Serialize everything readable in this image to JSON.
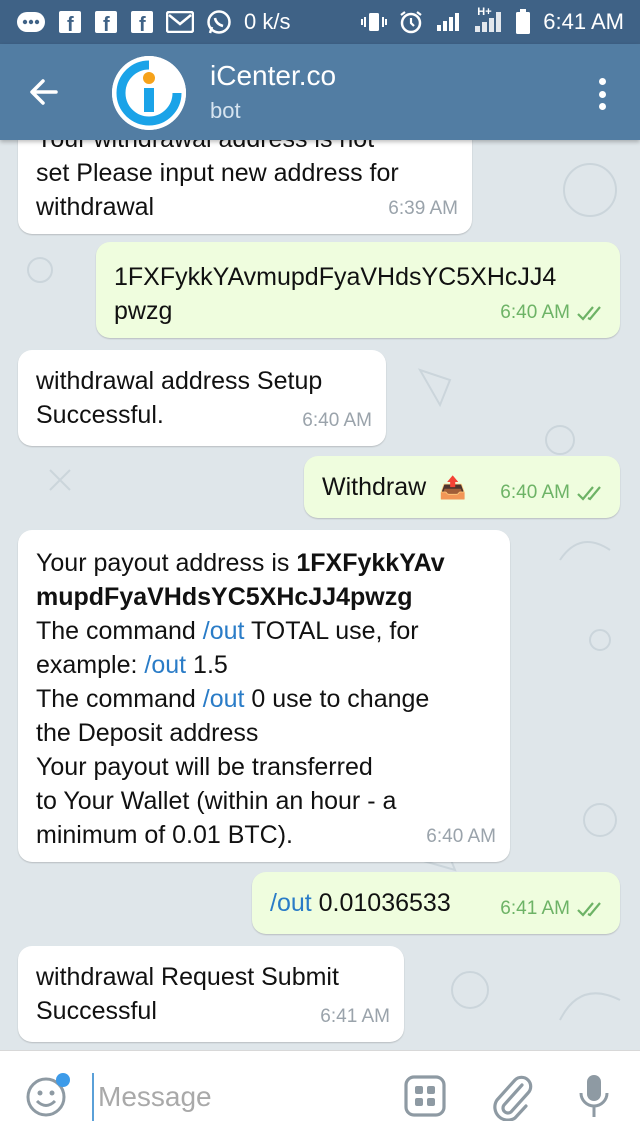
{
  "status_bar": {
    "speed": "0 k/s",
    "network": "H+",
    "time": "6:41 AM"
  },
  "header": {
    "title": "iCenter.co",
    "subtitle": "bot"
  },
  "messages": [
    {
      "dir": "in",
      "partial_line": "Your withdrawal address is not",
      "text": "set Please input new address for withdrawal",
      "line2": "withdrawal",
      "time": "6:39 AM"
    },
    {
      "dir": "out",
      "line1": "1FXFykkYAvmupdFyaVHdsYC5XHcJJ4",
      "line2": "pwzg",
      "time": "6:40 AM"
    },
    {
      "dir": "in",
      "line1": "withdrawal address Setup",
      "line2": "Successful.",
      "time": "6:40 AM"
    },
    {
      "dir": "out",
      "text": "Withdraw",
      "emoji": "📤",
      "time": "6:40 AM"
    },
    {
      "dir": "in",
      "l1_plain": "Your payout address is ",
      "l1_bold": "1FXFykkYAv",
      "l2_bold": "mupdFyaVHdsYC5XHcJJ4pwzg",
      "l3_a": "The command ",
      "l3_cmd": "/out",
      "l3_b": " TOTAL use, for",
      "l4_a": "example: ",
      "l4_cmd": "/out",
      "l4_b": " 1.5",
      "l5_a": "The command ",
      "l5_cmd": "/out",
      "l5_b": " 0 use to change",
      "l6": "the Deposit address",
      "l7": "Your payout will be transferred",
      "l8": "to Your Wallet (within an hour - a",
      "l9": "minimum of 0.01 BTC).",
      "time": "6:40 AM"
    },
    {
      "dir": "out",
      "cmd": "/out",
      "text": " 0.01036533",
      "time": "6:41 AM"
    },
    {
      "dir": "in",
      "line1": "withdrawal Request Submit",
      "line2": "Successful",
      "time": "6:41 AM"
    }
  ],
  "composer": {
    "placeholder": "Message"
  },
  "colors": {
    "status_bar": "#3f6286",
    "header": "#527da3",
    "outgoing_bubble": "#effdde",
    "incoming_bubble": "#ffffff",
    "link": "#2a7cc7",
    "read_check": "#6db366"
  }
}
